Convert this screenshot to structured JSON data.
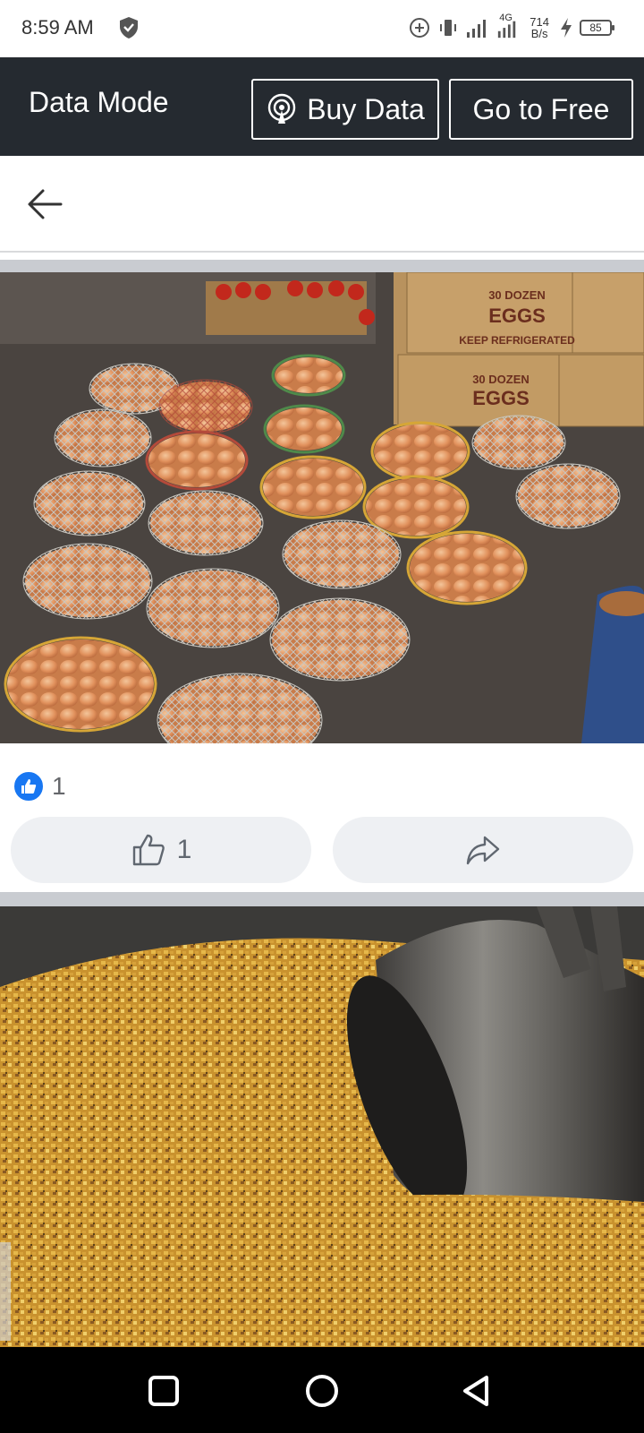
{
  "status_bar": {
    "time": "8:59 AM",
    "network": "4G",
    "speed_value": "714",
    "speed_unit": "B/s",
    "battery": "85"
  },
  "data_mode": {
    "title": "Data Mode",
    "buy_label": "Buy Data",
    "free_label": "Go to Free"
  },
  "photos": [
    {
      "subject": "eggs-in-wire-baskets",
      "box_lines": [
        "30 DOZEN",
        "EGGS",
        "KEEP REFRIGERATED"
      ]
    },
    {
      "subject": "grain-feed-with-metal-scoop"
    }
  ],
  "post": {
    "like_count": "1",
    "like_button_count": "1"
  },
  "colors": {
    "data_bar_bg": "#252a30",
    "like_blue": "#1877f2",
    "separator": "#c9ccd1",
    "action_bg": "#eef0f3"
  },
  "icons": {
    "back": "left-arrow-icon",
    "buy": "broadcast-icon",
    "like": "thumbs-up-icon",
    "share": "share-arrow-icon",
    "nav_recents": "square-icon",
    "nav_home": "circle-icon",
    "nav_back": "triangle-icon"
  }
}
